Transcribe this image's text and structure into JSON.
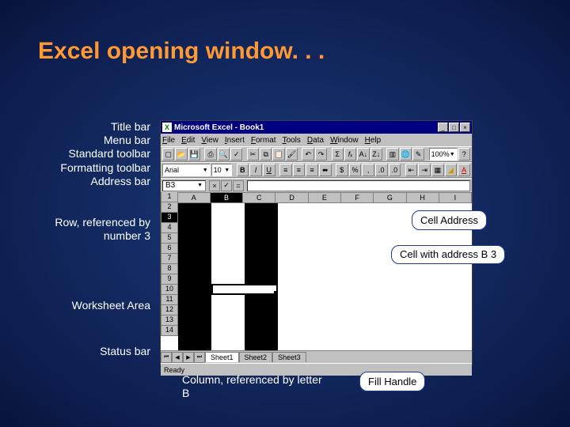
{
  "slide": {
    "title": "Excel opening window. . ."
  },
  "labels": {
    "titlebar": "Title bar",
    "menubar": "Menu bar",
    "stdtoolbar": "Standard toolbar",
    "fmttoolbar": "Formatting toolbar",
    "addressbar": "Address bar",
    "row": "Row, referenced by number 3",
    "worksheet": "Worksheet Area",
    "statusbar": "Status bar",
    "column": "Column, referenced by letter B"
  },
  "callouts": {
    "cell_address": "Cell Address",
    "cell_b3": "Cell with address B 3",
    "fill_handle": "Fill Handle"
  },
  "excel": {
    "title": "Microsoft Excel - Book1",
    "menus": [
      "File",
      "Edit",
      "View",
      "Insert",
      "Format",
      "Tools",
      "Data",
      "Window",
      "Help"
    ],
    "font_name": "Arial",
    "font_size": "10",
    "zoom": "100%",
    "name_box": "B3",
    "columns": [
      "A",
      "B",
      "C",
      "D",
      "E",
      "F",
      "G",
      "H",
      "I"
    ],
    "rows": [
      "1",
      "2",
      "3",
      "4",
      "5",
      "6",
      "7",
      "8",
      "9",
      "10",
      "11",
      "12",
      "13",
      "14"
    ],
    "sheets": [
      "Sheet1",
      "Sheet2",
      "Sheet3"
    ],
    "status": "Ready"
  }
}
